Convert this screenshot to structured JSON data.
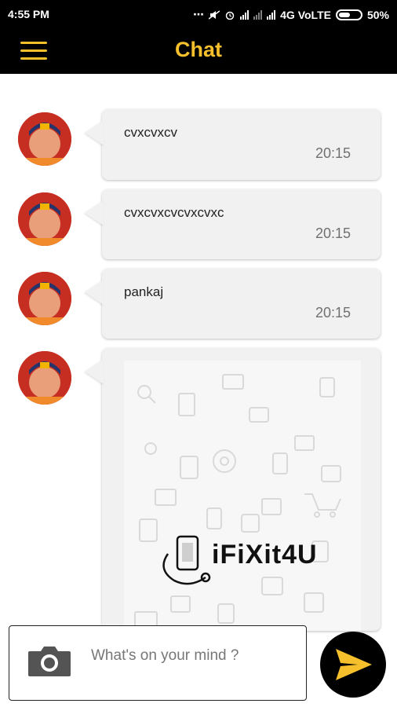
{
  "status_bar": {
    "time": "4:55 PM",
    "network": "4G VoLTE",
    "battery": "50%"
  },
  "app_bar": {
    "title": "Chat",
    "menu_icon": "hamburger-menu-icon",
    "accent_color": "#f5c02b"
  },
  "messages": [
    {
      "text": "cvxcvxcv",
      "time": "20:15"
    },
    {
      "text": "cvxcvxcvcvxcvxc",
      "time": "20:15"
    },
    {
      "text": "pankaj",
      "time": "20:15"
    }
  ],
  "image_message": {
    "logo_text": "iFiXit4U"
  },
  "composer": {
    "placeholder": "What's on your mind ?",
    "camera_icon": "camera-icon"
  },
  "send_button": {
    "icon": "send-icon",
    "icon_color": "#f5c02b"
  }
}
